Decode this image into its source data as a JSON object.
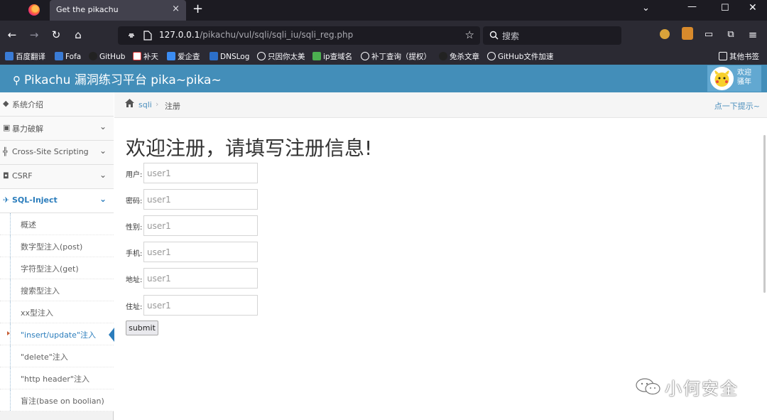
{
  "browser": {
    "tab_title": "Get the pikachu",
    "tab_close": "×",
    "new_tab": "+",
    "url_host": "127.0.0.1",
    "url_path": "/pikachu/vul/sqli/sqli_iu/sqli_reg.php",
    "search_placeholder": "搜索",
    "bookmarks": [
      "百度翻译",
      "Fofa",
      "GitHub",
      "补天",
      "爱企查",
      "DNSLog",
      "只因你太美",
      "ip查域名",
      "补丁查询（提权）",
      "免杀文章",
      "GitHub文件加速",
      "其他书签"
    ]
  },
  "site": {
    "title": "Pikachu 漏洞练习平台 pika~pika~",
    "welcome_line1": "欢迎",
    "welcome_line2": "骚年"
  },
  "sidebar": {
    "menus": [
      {
        "label": "系统介绍"
      },
      {
        "label": "暴力破解"
      },
      {
        "label": "Cross-Site Scripting"
      },
      {
        "label": "CSRF"
      },
      {
        "label": "SQL-Inject"
      }
    ],
    "sql_items": [
      "概述",
      "数字型注入(post)",
      "字符型注入(get)",
      "搜索型注入",
      "xx型注入",
      "\"insert/update\"注入",
      "\"delete\"注入",
      "\"http header\"注入",
      "盲注(base on boolian)"
    ]
  },
  "breadcrumb": {
    "link": "sqli",
    "separator": "›",
    "current": "注册",
    "hint": "点一下提示~"
  },
  "form": {
    "heading": "欢迎注册，请填写注册信息!",
    "fields": [
      {
        "label": "用户:",
        "placeholder": "user1"
      },
      {
        "label": "密码:",
        "placeholder": "user1"
      },
      {
        "label": "性别:",
        "placeholder": "user1"
      },
      {
        "label": "手机:",
        "placeholder": "user1"
      },
      {
        "label": "地址:",
        "placeholder": "user1"
      },
      {
        "label": "住址:",
        "placeholder": "user1"
      }
    ],
    "submit_label": "submit"
  },
  "watermark": "小何安全",
  "colors": {
    "header": "#438eb9",
    "active_menu": "#2b7dbc",
    "browser_bg": "#2b2a33"
  }
}
